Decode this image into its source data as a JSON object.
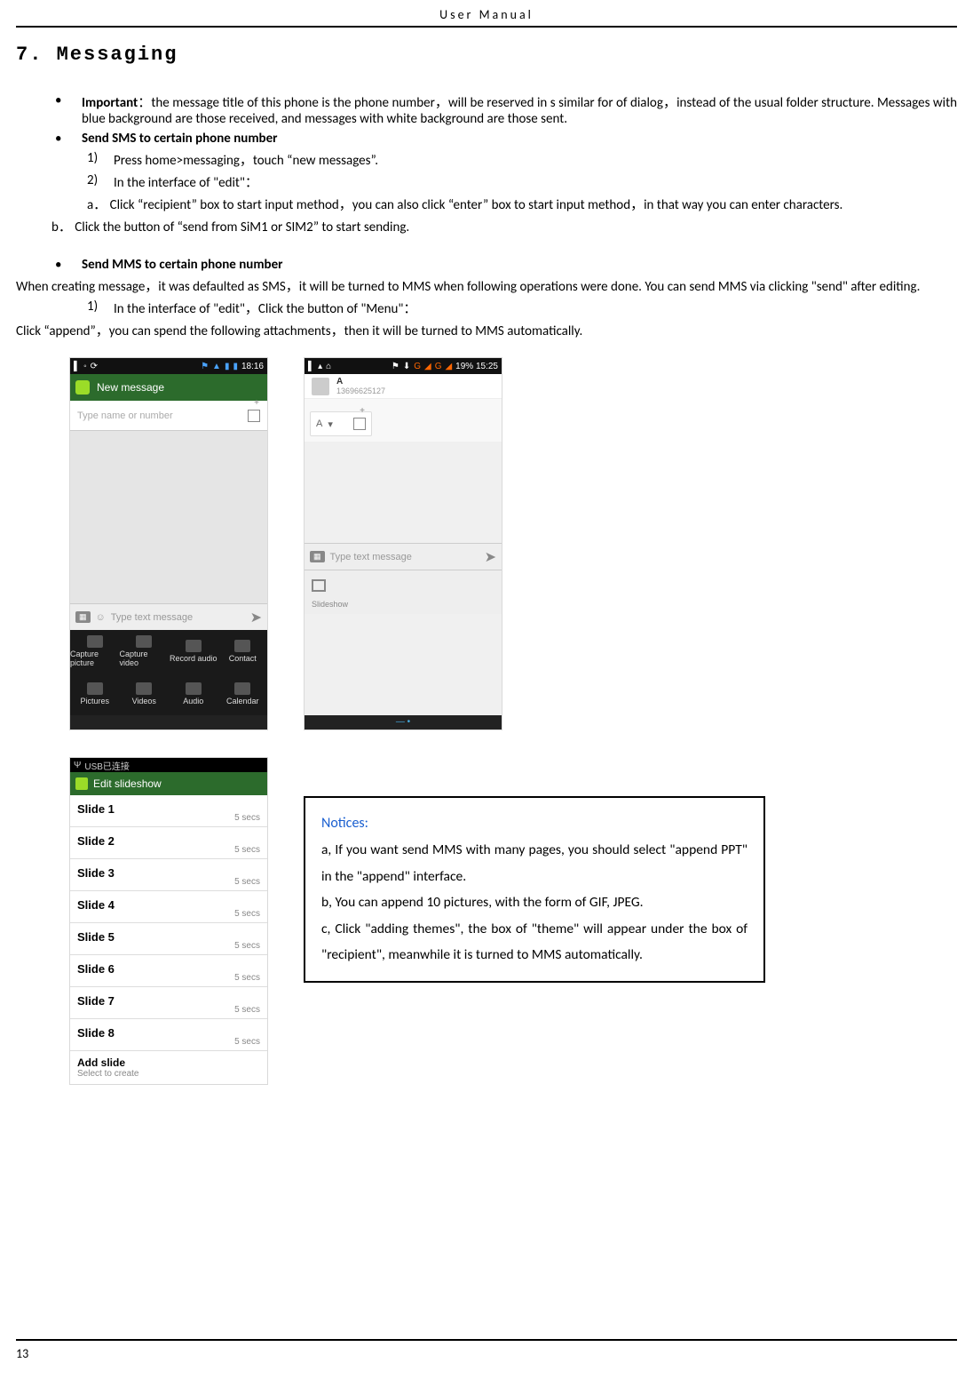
{
  "header": {
    "title": "User    Manual"
  },
  "section": {
    "heading": "7. Messaging"
  },
  "bullets": {
    "important_label": "Important",
    "important_text": "：the message title of this phone is the phone number，will be reserved in s similar for of dialog，instead of the usual folder structure. Messages with blue background are those received, and messages with white background are those sent.",
    "send_sms_label": "Send SMS  to certain phone number",
    "sms_step1": "Press home>messaging，touch “new messages”.",
    "sms_step2": "In the interface of \"edit\"：",
    "sms_a": "a．  Click  “recipient” box to start input method，you can also click “enter” box to start input method，in that way you can enter characters.",
    "sms_b": "b．  Click the button of  “send from SiM1 or SIM2” to start sending.",
    "send_mms_label": "Send MMS to certain phone number",
    "mms_intro": "When creating message，it was defaulted as SMS，it will be turned to MMS when following operations were done. You can send MMS via clicking \"send\" after editing.",
    "mms_step1": "In the interface of \"edit\"，Click the button of \"Menu\"：",
    "mms_click": "Click  “append”，you can spend the following attachments，then it will be turned to MMS automatically."
  },
  "shot1": {
    "status_time": "18:16",
    "bar_title": "New message",
    "recipient_ph": "Type name or number",
    "compose_ph": "Type text message",
    "attach": [
      "Capture picture",
      "Capture video",
      "Record audio",
      "Contact",
      "Pictures",
      "Videos",
      "Audio",
      "Calendar"
    ]
  },
  "shot2": {
    "status_right": "19% 15:25",
    "status_g": "G",
    "contact_name": "A",
    "contact_num": "13696625127",
    "chip": "A",
    "compose_ph": "Type text message",
    "slideshow": "Slideshow"
  },
  "shot3": {
    "usb": "USB已连接",
    "bar_title": "Edit slideshow",
    "slides": [
      "Slide 1",
      "Slide 2",
      "Slide 3",
      "Slide 4",
      "Slide 5",
      "Slide 6",
      "Slide 7",
      "Slide 8"
    ],
    "dur": "5 secs",
    "add_title": "Add slide",
    "add_sub": "Select to create"
  },
  "notices": {
    "title": "Notices:",
    "a": "a, If you want send MMS with many pages, you should select \"append PPT\" in the \"append\" interface.",
    "b": "b, You can append 10 pictures, with the form of GIF, JPEG.",
    "c": "c, Click \"adding themes\", the box of \"theme\" will appear under the box of \"recipient\", meanwhile it is turned to MMS automatically."
  },
  "footer": {
    "page": "13"
  }
}
